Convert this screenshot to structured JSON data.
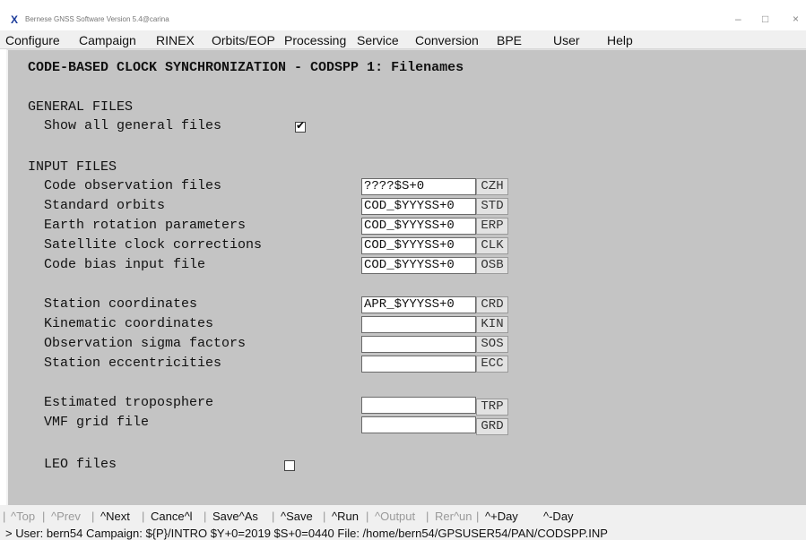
{
  "window": {
    "title": "Bernese GNSS Software Version 5.4@carina",
    "logo": "X",
    "controls": [
      "–",
      "□",
      "×"
    ]
  },
  "menu": [
    "Configure",
    "Campaign",
    "RINEX",
    "Orbits/EOP",
    "Processing",
    "Service",
    "Conversion",
    "BPE",
    "User",
    "Help"
  ],
  "panel": {
    "title": "CODE-BASED CLOCK SYNCHRONIZATION - CODSPP 1: Filenames",
    "general_heading": "GENERAL FILES",
    "show_all_label": "Show all general files",
    "show_all_checked": true,
    "input_heading": "INPUT FILES",
    "rows": [
      {
        "label": "Code observation files",
        "value": "????$S+0",
        "ext": "CZH"
      },
      {
        "label": "Standard orbits",
        "value": "COD_$YYYSS+0",
        "ext": "STD"
      },
      {
        "label": "Earth rotation parameters",
        "value": "COD_$YYYSS+0",
        "ext": "ERP"
      },
      {
        "label": "Satellite clock corrections",
        "value": "COD_$YYYSS+0",
        "ext": "CLK"
      },
      {
        "label": "Code bias input file",
        "value": "COD_$YYYSS+0",
        "ext": "OSB"
      },
      {
        "label": "Station coordinates",
        "value": "APR_$YYYSS+0",
        "ext": "CRD"
      },
      {
        "label": "Kinematic coordinates",
        "value": "",
        "ext": "KIN"
      },
      {
        "label": "Observation sigma factors",
        "value": "",
        "ext": "SOS"
      },
      {
        "label": "Station eccentricities",
        "value": "",
        "ext": "ECC"
      },
      {
        "label": "Estimated troposphere",
        "value": "",
        "ext": "TRP"
      },
      {
        "label": "VMF grid file",
        "value": "",
        "ext": "GRD"
      }
    ],
    "leo_label": "LEO files",
    "leo_checked": false
  },
  "buttons": [
    {
      "label": "^Top",
      "enabled": false
    },
    {
      "label": "^Prev",
      "enabled": false
    },
    {
      "label": "^Next",
      "enabled": true
    },
    {
      "label": "Cance^l",
      "enabled": true
    },
    {
      "label": "Save^As",
      "enabled": true
    },
    {
      "label": "^Save",
      "enabled": true
    },
    {
      "label": "^Run",
      "enabled": true
    },
    {
      "label": "^Output",
      "enabled": false
    },
    {
      "label": "Rer^un",
      "enabled": false
    },
    {
      "label": "^+Day",
      "enabled": true
    },
    {
      "label": "^-Day",
      "enabled": true
    }
  ],
  "status": "> User: bern54  Campaign: ${P}/INTRO  $Y+0=2019  $S+0=0440  File: /home/bern54/GPSUSER54/PAN/CODSPP.INP",
  "colors": {
    "panel_bg": "#c4c4c4",
    "menubar_bg": "#f0f0f0",
    "logo": "#1a3a9a"
  }
}
